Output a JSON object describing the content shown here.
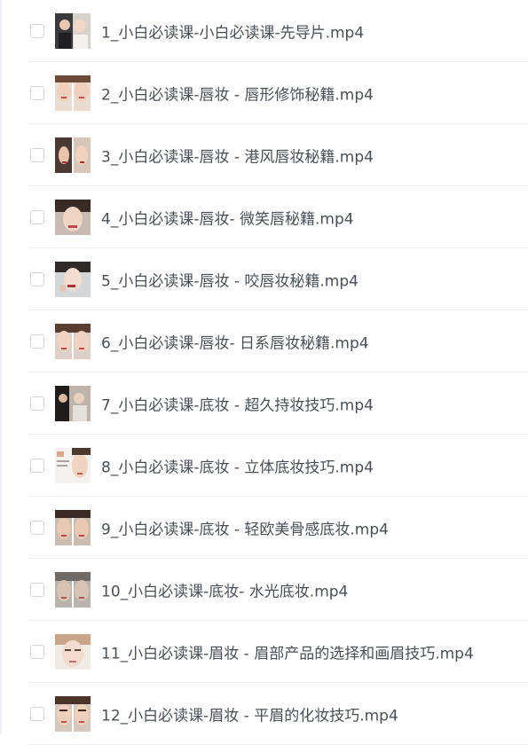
{
  "file_list": {
    "items": [
      {
        "name": "1_小白必读课-小白必读课-先导片.mp4",
        "thumbnail": "video-thumbnail-icon"
      },
      {
        "name": "2_小白必读课-唇妆 - 唇形修饰秘籍.mp4",
        "thumbnail": "video-thumbnail-icon"
      },
      {
        "name": "3_小白必读课-唇妆 - 港风唇妆秘籍.mp4",
        "thumbnail": "video-thumbnail-icon"
      },
      {
        "name": "4_小白必读课-唇妆- 微笑唇秘籍.mp4",
        "thumbnail": "video-thumbnail-icon"
      },
      {
        "name": "5_小白必读课-唇妆 - 咬唇妆秘籍.mp4",
        "thumbnail": "video-thumbnail-icon"
      },
      {
        "name": "6_小白必读课-唇妆- 日系唇妆秘籍.mp4",
        "thumbnail": "video-thumbnail-icon"
      },
      {
        "name": "7_小白必读课-底妆 - 超久持妆技巧.mp4",
        "thumbnail": "video-thumbnail-icon"
      },
      {
        "name": "8_小白必读课-底妆 - 立体底妆技巧.mp4",
        "thumbnail": "video-thumbnail-icon"
      },
      {
        "name": "9_小白必读课-底妆 - 轻欧美骨感底妆.mp4",
        "thumbnail": "video-thumbnail-icon"
      },
      {
        "name": "10_小白必读课-底妆- 水光底妆.mp4",
        "thumbnail": "video-thumbnail-icon"
      },
      {
        "name": "11_小白必读课-眉妆 - 眉部产品的选择和画眉技巧.mp4",
        "thumbnail": "video-thumbnail-icon"
      },
      {
        "name": "12_小白必读课-眉妆 - 平眉的化妆技巧.mp4",
        "thumbnail": "video-thumbnail-icon"
      }
    ]
  }
}
